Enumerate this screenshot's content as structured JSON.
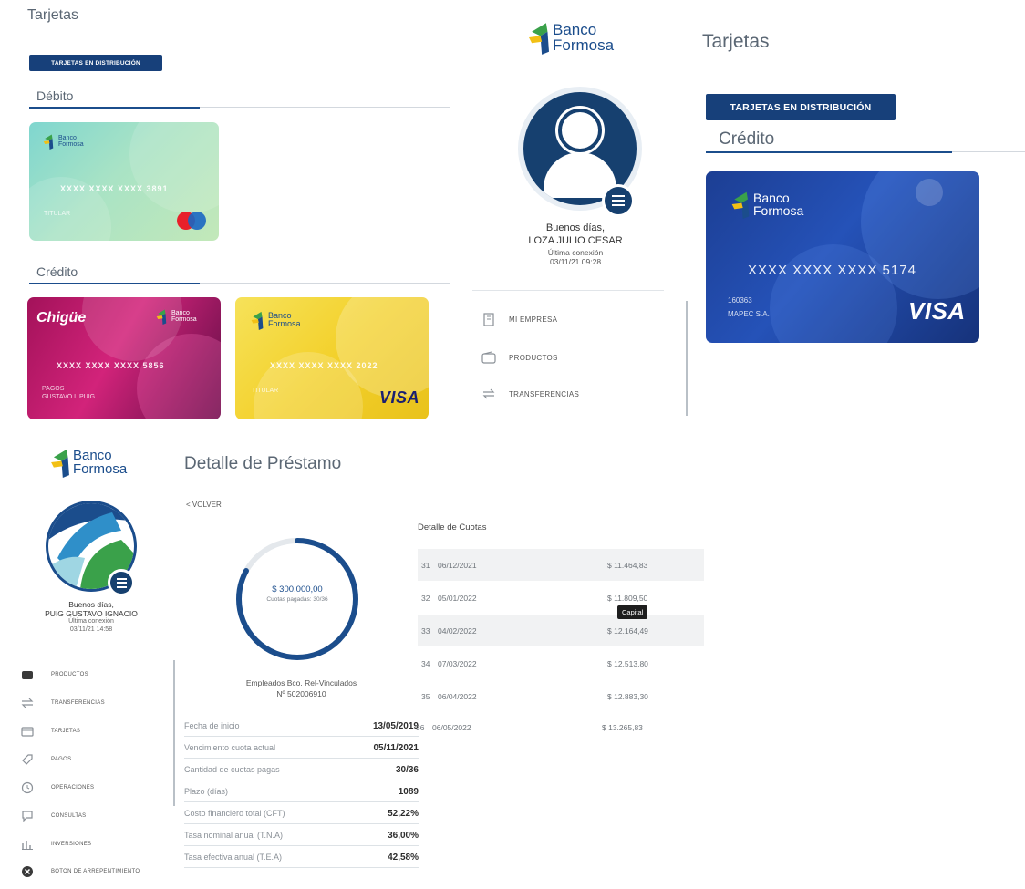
{
  "panel_debit": {
    "title": "Tarjetas",
    "badge": "TARJETAS EN DISTRIBUCIÓN",
    "debit_heading": "Débito",
    "credit_heading": "Crédito",
    "debit_card": {
      "logo_line1": "Banco",
      "logo_line2": "Formosa",
      "number": "XXXX XXXX XXXX 3891",
      "holder": "TITULAR"
    },
    "chigue_card": {
      "brand": "Chigüe",
      "logo_line1": "Banco",
      "logo_line2": "Formosa",
      "number": "XXXX XXXX XXXX 5856",
      "holder_line1": "PAGOS",
      "holder_line2": "GUSTAVO I. PUIG"
    },
    "gold_card": {
      "logo_line1": "Banco",
      "logo_line2": "Formosa",
      "number": "XXXX XXXX XXXX 2022",
      "holder": "TITULAR",
      "network": "VISA"
    }
  },
  "panel_profile": {
    "logo_line1": "Banco",
    "logo_line2": "Formosa",
    "greeting": "Buenos días,",
    "user_name": "LOZA JULIO CESAR",
    "last_login_label": "Última conexión",
    "last_login_value": "03/11/21 09:28",
    "menu": [
      {
        "icon": "building-icon",
        "label": "MI EMPRESA"
      },
      {
        "icon": "wallet-icon",
        "label": "PRODUCTOS"
      },
      {
        "icon": "transfer-icon",
        "label": "TRANSFERENCIAS"
      }
    ]
  },
  "panel_credit": {
    "title": "Tarjetas",
    "badge": "TARJETAS EN DISTRIBUCIÓN",
    "credit_heading": "Crédito",
    "card": {
      "logo_line1": "Banco",
      "logo_line2": "Formosa",
      "number": "XXXX XXXX XXXX 5174",
      "holder_line1": "160363",
      "holder_line2": "MAPEC S.A.",
      "network": "VISA"
    }
  },
  "panel_loan": {
    "logo_line1": "Banco",
    "logo_line2": "Formosa",
    "page_title": "Detalle de Préstamo",
    "back_label": "< VOLVER",
    "greeting": "Buenos días,",
    "user_name": "PUIG GUSTAVO IGNACIO",
    "last_login_label": "Última conexión",
    "last_login_value": "03/11/21 14:58",
    "menu": [
      {
        "icon": "wallet-icon",
        "label": "PRODUCTOS"
      },
      {
        "icon": "transfer-icon",
        "label": "TRANSFERENCIAS"
      },
      {
        "icon": "card-icon",
        "label": "TARJETAS"
      },
      {
        "icon": "tag-icon",
        "label": "PAGOS"
      },
      {
        "icon": "clock-icon",
        "label": "OPERACIONES"
      },
      {
        "icon": "chat-icon",
        "label": "CONSULTAS"
      },
      {
        "icon": "chart-icon",
        "label": "INVERSIONES"
      },
      {
        "icon": "close-circle-icon",
        "label": "BOTON DE ARREPENTIMIENTO"
      }
    ],
    "ring": {
      "amount": "$ 300.000,00",
      "caption": "Cuotas pagadas: 30/36",
      "progress": 0.83
    },
    "loan_name": "Empleados Bco. Rel-Vinculados",
    "loan_number": "Nº 502006910",
    "details": [
      {
        "label": "Fecha de inicio",
        "value": "13/05/2019"
      },
      {
        "label": "Vencimiento cuota actual",
        "value": "05/11/2021"
      },
      {
        "label": "Cantidad de cuotas pagas",
        "value": "30/36"
      },
      {
        "label": "Plazo (días)",
        "value": "1089"
      },
      {
        "label": "Costo financiero total (CFT)",
        "value": "52,22%"
      },
      {
        "label": "Tasa nominal anual (T.N.A)",
        "value": "36,00%"
      },
      {
        "label": "Tasa efectiva anual (T.E.A)",
        "value": "42,58%"
      }
    ],
    "cuotas_title": "Detalle de Cuotas",
    "cuotas": [
      {
        "n": "31",
        "date": "06/12/2021",
        "amount": "$ 11.464,83"
      },
      {
        "n": "32",
        "date": "05/01/2022",
        "amount": "$ 11.809,50"
      },
      {
        "n": "33",
        "date": "04/02/2022",
        "amount": "$ 12.164,49"
      },
      {
        "n": "34",
        "date": "07/03/2022",
        "amount": "$ 12.513,80"
      },
      {
        "n": "35",
        "date": "06/04/2022",
        "amount": "$ 12.883,30"
      },
      {
        "n": "36",
        "date": "06/05/2022",
        "amount": "$ 13.265,83"
      }
    ],
    "tooltip": "Capital"
  },
  "colors": {
    "brand_blue": "#17407a",
    "accent_green": "#3aa14a"
  }
}
